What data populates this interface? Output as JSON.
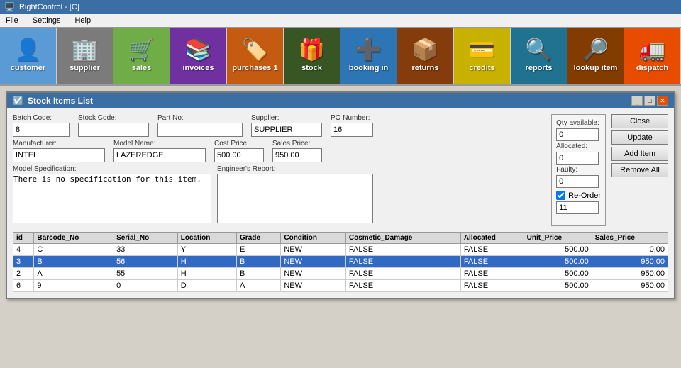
{
  "app": {
    "title": "RightControl - [C]"
  },
  "menu": {
    "items": [
      "File",
      "Settings",
      "Help"
    ]
  },
  "toolbar": {
    "buttons": [
      {
        "id": "customer",
        "label": "customer",
        "icon": "👤",
        "color": "#5b9bd5"
      },
      {
        "id": "supplier",
        "label": "supplier",
        "icon": "🏢",
        "color": "#7b7b7b"
      },
      {
        "id": "sales",
        "label": "sales",
        "icon": "🛒",
        "color": "#70ad47"
      },
      {
        "id": "invoices",
        "label": "invoices",
        "icon": "📚",
        "color": "#7030a0"
      },
      {
        "id": "purchases 1",
        "label": "purchases 1",
        "icon": "🏷️",
        "color": "#c55a11"
      },
      {
        "id": "stock",
        "label": "stock",
        "icon": "🎁",
        "color": "#4a7c2f"
      },
      {
        "id": "booking_in",
        "label": "booking in",
        "icon": "➕",
        "color": "#2e75b6"
      },
      {
        "id": "returns",
        "label": "returns",
        "icon": "📦",
        "color": "#843c0c"
      },
      {
        "id": "credits",
        "label": "credits",
        "icon": "💳",
        "color": "#c9a000"
      },
      {
        "id": "reports",
        "label": "reports",
        "icon": "🔍",
        "color": "#1f7391"
      },
      {
        "id": "lookup_item",
        "label": "lookup item",
        "icon": "🔎",
        "color": "#833c00"
      },
      {
        "id": "dispatch",
        "label": "dispatch",
        "icon": "🚛",
        "color": "#e84c00"
      }
    ]
  },
  "dialog": {
    "title": "Stock Items List",
    "form": {
      "batch_code_label": "Batch Code:",
      "batch_code_value": "8",
      "stock_code_label": "Stock Code:",
      "stock_code_value": "",
      "part_no_label": "Part No:",
      "part_no_value": "",
      "supplier_label": "Supplier:",
      "supplier_value": "SUPPLIER",
      "po_number_label": "PO Number:",
      "po_number_value": "16",
      "manufacturer_label": "Manufacturer:",
      "manufacturer_value": "INTEL",
      "model_name_label": "Model Name:",
      "model_name_value": "LAZEREDGE",
      "cost_price_label": "Cost Price:",
      "cost_price_value": "500.00",
      "sales_price_label": "Sales Price:",
      "sales_price_value": "950.00",
      "model_spec_label": "Model Specification:",
      "model_spec_value": "There is no specification for this item.",
      "engineers_report_label": "Engineer's Report:",
      "engineers_report_value": ""
    },
    "right_panel": {
      "qty_available_label": "Qty available:",
      "qty_available_value": "0",
      "allocated_label": "Allocated:",
      "allocated_value": "0",
      "faulty_label": "Faulty:",
      "faulty_value": "0",
      "reorder_label": "Re-Order",
      "reorder_checked": true,
      "reorder_value": "11"
    },
    "buttons": {
      "close": "Close",
      "update": "Update",
      "add_item": "Add Item",
      "remove_all": "Remove All"
    },
    "table": {
      "headers": [
        "id",
        "Barcode_No",
        "Serial_No",
        "Location",
        "Grade",
        "Condition",
        "Cosmetic_Damage",
        "Allocated",
        "Unit_Price",
        "Sales_Price"
      ],
      "rows": [
        {
          "id": "4",
          "barcode_no": "C",
          "serial_no": "33",
          "location": "Y",
          "grade": "E",
          "condition": "NEW",
          "cosmetic_damage": "FALSE",
          "allocated": "FALSE",
          "unit_price": "500.00",
          "sales_price": "0.00",
          "selected": false
        },
        {
          "id": "3",
          "barcode_no": "B",
          "serial_no": "56",
          "location": "H",
          "grade": "B",
          "condition": "NEW",
          "cosmetic_damage": "FALSE",
          "allocated": "FALSE",
          "unit_price": "500.00",
          "sales_price": "950.00",
          "selected": true
        },
        {
          "id": "2",
          "barcode_no": "A",
          "serial_no": "55",
          "location": "H",
          "grade": "B",
          "condition": "NEW",
          "cosmetic_damage": "FALSE",
          "allocated": "FALSE",
          "unit_price": "500.00",
          "sales_price": "950.00",
          "selected": false
        },
        {
          "id": "6",
          "barcode_no": "9",
          "serial_no": "0",
          "location": "D",
          "grade": "A",
          "condition": "NEW",
          "cosmetic_damage": "FALSE",
          "allocated": "FALSE",
          "unit_price": "500.00",
          "sales_price": "950.00",
          "selected": false
        }
      ]
    }
  }
}
